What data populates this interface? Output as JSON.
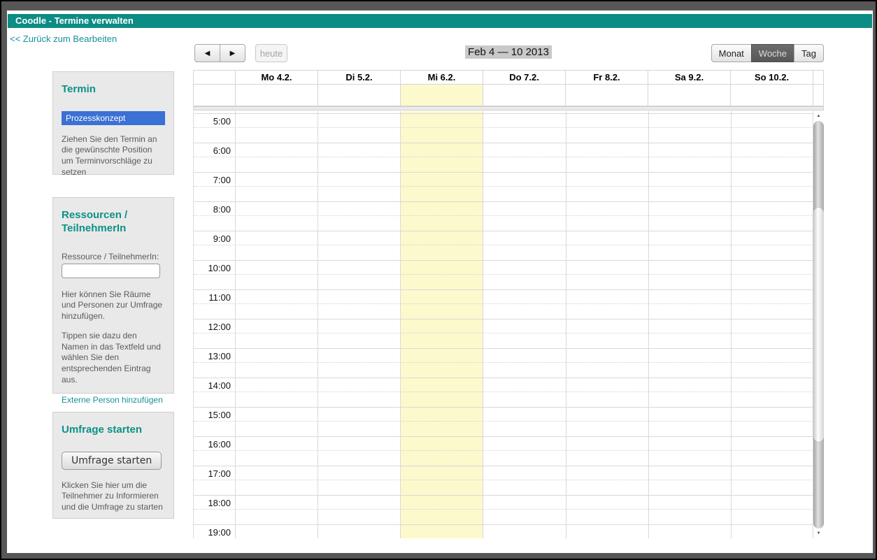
{
  "app": {
    "title": "Coodle - Termine verwalten",
    "back_link": "<< Zurück zum Bearbeiten"
  },
  "colors": {
    "accent_teal": "#0d8c85",
    "heading_teal": "#0c9186",
    "link_teal": "#16909c",
    "event_blue": "#3b70d4",
    "today_yellow": "#fcf9cc",
    "active_view_bg": "#5f5f5f"
  },
  "sidebar": {
    "termin": {
      "heading": "Termin",
      "event_label": "Prozesskonzept",
      "hint": "Ziehen Sie den Termin an die gewünschte Position um Terminvorschläge zu setzen"
    },
    "ressourcen": {
      "heading": "Ressourcen / TeilnehmerIn",
      "input_label": "Ressource / TeilnehmerIn:",
      "input_value": "",
      "hint1": "Hier können Sie Räume und Personen zur Umfrage hinzufügen.",
      "hint2": "Tippen sie dazu den Namen in das Textfeld und wählen Sie den entsprechenden Eintrag aus.",
      "link_label": "Externe Person hinzufügen"
    },
    "umfrage": {
      "heading": "Umfrage starten",
      "button_label": "Umfrage starten",
      "hint": "Klicken Sie hier um die Teilnehmer zu Informieren und die Umfrage zu starten"
    }
  },
  "toolbar": {
    "prev_icon": "◀",
    "next_icon": "▶",
    "today_label": "heute",
    "title": "Feb 4 — 10 2013",
    "views": [
      {
        "id": "monat",
        "label": "Monat",
        "active": false
      },
      {
        "id": "woche",
        "label": "Woche",
        "active": true
      },
      {
        "id": "tag",
        "label": "Tag",
        "active": false
      }
    ]
  },
  "calendar": {
    "day_headers": [
      "Mo 4.2.",
      "Di 5.2.",
      "Mi 6.2.",
      "Do 7.2.",
      "Fr 8.2.",
      "Sa 9.2.",
      "So 10.2."
    ],
    "today_index": 2,
    "hour_labels": [
      "5:00",
      "6:00",
      "7:00",
      "8:00",
      "9:00",
      "10:00",
      "11:00",
      "12:00",
      "13:00",
      "14:00",
      "15:00",
      "16:00",
      "17:00",
      "18:00",
      "19:00"
    ],
    "scrollbar": {
      "up_icon": "▲",
      "down_icon": "▼"
    }
  }
}
